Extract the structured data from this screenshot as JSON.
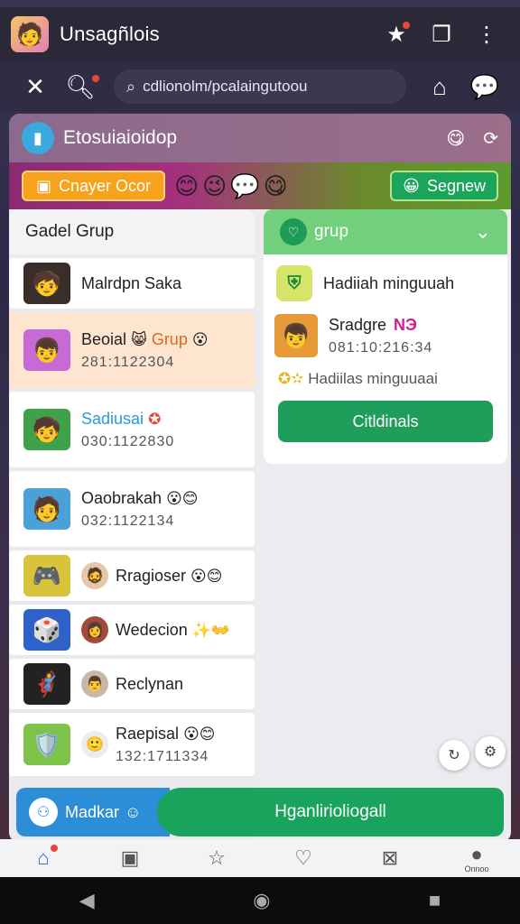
{
  "appbar": {
    "title": "Unsagñlois",
    "icons": [
      "star-icon",
      "window-icon",
      "more-icon"
    ]
  },
  "search": {
    "value": "cdlionolm/pcalaingutoou"
  },
  "card": {
    "header_title": "Etosuiaioidop",
    "banner": {
      "left_button": "Cnayer Ocor",
      "right_button": "Segnew"
    }
  },
  "left_panel": {
    "title": "Gadel Grup",
    "items": [
      {
        "name": "Malrdpn Saka",
        "time": ""
      },
      {
        "name": "Beoial",
        "name_accent": "Grup",
        "time": "281:1122304"
      },
      {
        "name": "Sadiusai",
        "time": "030:1122830"
      },
      {
        "name": "Oaobrakah",
        "time": "032:1122134"
      },
      {
        "name": "Rragioser",
        "time": ""
      },
      {
        "name": "Wedecion",
        "time": ""
      },
      {
        "name": "Reclynan",
        "time": ""
      },
      {
        "name": "Raepisal",
        "time": "132:1711334"
      }
    ]
  },
  "right_panel": {
    "title": "grup",
    "reward_title": "Hadiiah minguuah",
    "user_name": "Sradgre",
    "user_badge": "NЭ",
    "user_time": "081:10:216:34",
    "subtitle": "Hadiilas minguuaai",
    "button": "Citldinals"
  },
  "action_bar": {
    "left_label": "Madkar",
    "right_label": "Hganlirioliogall"
  },
  "bottom_nav": {
    "last_label": "Onnoo"
  },
  "colors": {
    "header": "#9b6e8a",
    "green": "#1aa35d",
    "blue": "#2b8ed6",
    "orange": "#f7a21b"
  }
}
